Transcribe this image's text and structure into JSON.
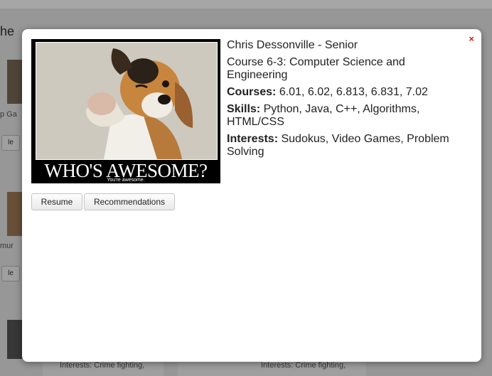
{
  "background": {
    "heading_fragment": "he",
    "card_text_1": "p Ga",
    "card_text_2": "mur",
    "btn_fragment": "le",
    "footer_text_1": "Interests: Crime fighting,",
    "footer_text_2": "Interests: Crime fighting,"
  },
  "modal": {
    "close_glyph": "×",
    "photo": {
      "caption": "WHO'S AWESOME?",
      "subcaption": "You're awesome."
    },
    "buttons": {
      "resume": "Resume",
      "recommendations": "Recommendations"
    },
    "profile": {
      "name_line": "Chris Dessonville - Senior",
      "course": "Course 6-3: Computer Science and Engineering",
      "courses_label": "Courses:",
      "courses_value": "6.01, 6.02, 6.813, 6.831, 7.02",
      "skills_label": "Skills:",
      "skills_value": "Python, Java, C++, Algorithms, HTML/CSS",
      "interests_label": "Interests:",
      "interests_value": "Sudokus, Video Games, Problem Solving"
    }
  },
  "colors": {
    "close": "#d62020",
    "photo_frame": "#000000"
  }
}
